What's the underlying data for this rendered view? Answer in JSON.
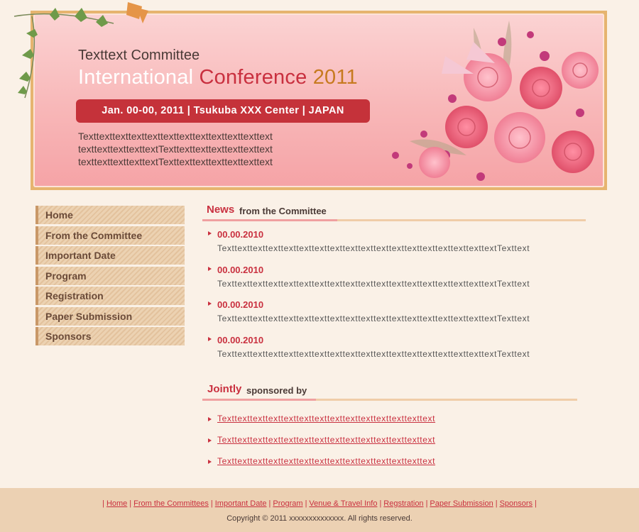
{
  "banner": {
    "subtitle": "Texttext Committee",
    "title_part1": "International",
    "title_part2": "Conference",
    "title_part3": "2011",
    "date_location": "Jan. 00-00, 2011 | Tsukuba XXX Center | JAPAN",
    "description_lines": [
      "Texttexttexttexttexttexttexttexttexttexttexttext",
      "texttexttexttexttextTexttexttexttexttexttexttext",
      "texttexttexttexttextTexttexttexttexttexttexttext"
    ]
  },
  "sidebar": {
    "items": [
      {
        "label": "Home"
      },
      {
        "label": "From the Committee"
      },
      {
        "label": "Important Date"
      },
      {
        "label": "Program"
      },
      {
        "label": "Registration"
      },
      {
        "label": "Paper Submission"
      },
      {
        "label": "Sponsors"
      }
    ]
  },
  "news": {
    "heading_accent": "News",
    "heading_rest": "from the Committee",
    "items": [
      {
        "date": "00.00.2010",
        "text": "TexttexttexttexttexttexttexttexttexttexttexttexttexttexttexttexttexttextTexttext"
      },
      {
        "date": "00.00.2010",
        "text": "TexttexttexttexttexttexttexttexttexttexttexttexttexttexttexttexttexttextTexttext"
      },
      {
        "date": "00.00.2010",
        "text": "TexttexttexttexttexttexttexttexttexttexttexttexttexttexttexttexttexttextTexttext"
      },
      {
        "date": "00.00.2010",
        "text": "TexttexttexttexttexttexttexttexttexttexttexttexttexttexttexttexttexttextTexttext"
      }
    ]
  },
  "sponsors": {
    "heading_accent": "Jointly",
    "heading_rest": "sponsored by",
    "items": [
      {
        "label": "Texttexttexttexttexttexttexttexttexttexttexttexttexttext"
      },
      {
        "label": "Texttexttexttexttexttexttexttexttexttexttexttexttexttext"
      },
      {
        "label": "Texttexttexttexttexttexttexttexttexttexttexttexttexttext"
      }
    ]
  },
  "footer": {
    "links": [
      {
        "label": "Home"
      },
      {
        "label": "From the Committees"
      },
      {
        "label": "Important Date"
      },
      {
        "label": "Program"
      },
      {
        "label": "Venue & Travel Info"
      },
      {
        "label": "Regstration"
      },
      {
        "label": "Paper Submission"
      },
      {
        "label": "Sponsors"
      }
    ],
    "copyright": "Copyright © 2011 xxxxxxxxxxxxxx. All rights reserved."
  },
  "colors": {
    "accent_red": "#c9303f",
    "banner_frame": "#e6b46f",
    "page_bg": "#faf1e7",
    "footer_bg": "#ecd1b3"
  }
}
